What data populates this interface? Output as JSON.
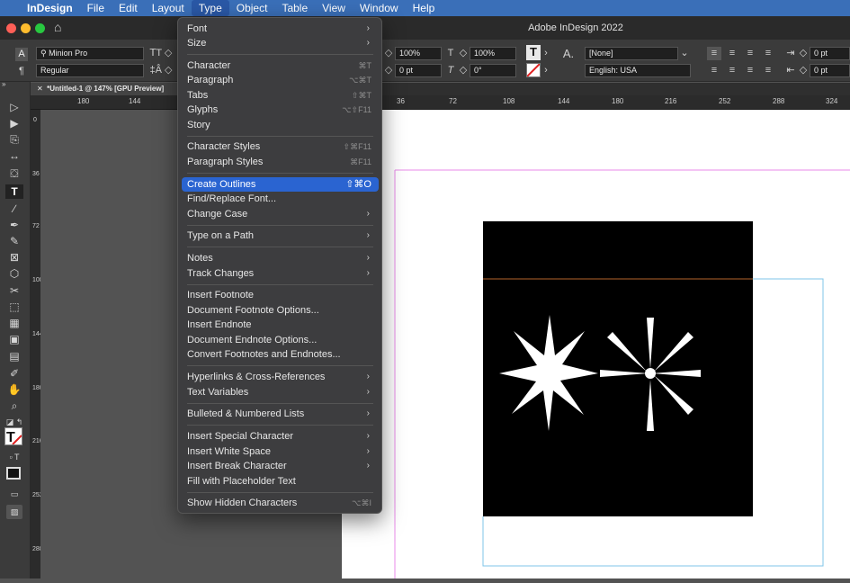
{
  "menubar": {
    "apple": "",
    "items": [
      "InDesign",
      "File",
      "Edit",
      "Layout",
      "Type",
      "Object",
      "Table",
      "View",
      "Window",
      "Help"
    ],
    "active": "Type"
  },
  "window": {
    "title": "Adobe InDesign 2022"
  },
  "control_panel": {
    "font_family": "Minion Pro",
    "font_style": "Regular",
    "vertical_scale": "100%",
    "horizontal_scale": "100%",
    "baseline_shift": "0 pt",
    "skew": "0°",
    "character_style": "[None]",
    "language": "English: USA",
    "left_indent": "0 pt",
    "first_line_indent": "0 pt"
  },
  "document_tab": {
    "label": "*Untitled-1 @ 147% [GPU Preview]"
  },
  "ruler": {
    "horizontal_ticks": [
      "180",
      "144",
      "36",
      "72",
      "108",
      "144",
      "180",
      "216",
      "252",
      "288",
      "324"
    ],
    "vertical_ticks": [
      "0",
      "36",
      "72",
      "108",
      "144",
      "180",
      "216",
      "252",
      "288"
    ]
  },
  "type_menu": {
    "items": [
      {
        "label": "Font",
        "shortcut": "",
        "submenu": true
      },
      {
        "label": "Size",
        "shortcut": "",
        "submenu": true
      },
      {
        "label": "Character",
        "shortcut": "⌘T",
        "submenu": false
      },
      {
        "label": "Paragraph",
        "shortcut": "⌥⌘T",
        "submenu": false
      },
      {
        "label": "Tabs",
        "shortcut": "⇧⌘T",
        "submenu": false
      },
      {
        "label": "Glyphs",
        "shortcut": "⌥⇧F11",
        "submenu": false
      },
      {
        "label": "Story",
        "shortcut": "",
        "submenu": false
      },
      {
        "label": "Character Styles",
        "shortcut": "⇧⌘F11",
        "submenu": false
      },
      {
        "label": "Paragraph Styles",
        "shortcut": "⌘F11",
        "submenu": false
      },
      {
        "label": "Create Outlines",
        "shortcut": "⇧⌘O",
        "submenu": false,
        "highlighted": true
      },
      {
        "label": "Find/Replace Font...",
        "shortcut": "",
        "submenu": false
      },
      {
        "label": "Change Case",
        "shortcut": "",
        "submenu": true
      },
      {
        "label": "Type on a Path",
        "shortcut": "",
        "submenu": true
      },
      {
        "label": "Notes",
        "shortcut": "",
        "submenu": true
      },
      {
        "label": "Track Changes",
        "shortcut": "",
        "submenu": true
      },
      {
        "label": "Insert Footnote",
        "shortcut": "",
        "submenu": false
      },
      {
        "label": "Document Footnote Options...",
        "shortcut": "",
        "submenu": false
      },
      {
        "label": "Insert Endnote",
        "shortcut": "",
        "submenu": false
      },
      {
        "label": "Document Endnote Options...",
        "shortcut": "",
        "submenu": false
      },
      {
        "label": "Convert Footnotes and Endnotes...",
        "shortcut": "",
        "submenu": false
      },
      {
        "label": "Hyperlinks & Cross-References",
        "shortcut": "",
        "submenu": true
      },
      {
        "label": "Text Variables",
        "shortcut": "",
        "submenu": true
      },
      {
        "label": "Bulleted & Numbered Lists",
        "shortcut": "",
        "submenu": true
      },
      {
        "label": "Insert Special Character",
        "shortcut": "",
        "submenu": true
      },
      {
        "label": "Insert White Space",
        "shortcut": "",
        "submenu": true
      },
      {
        "label": "Insert Break Character",
        "shortcut": "",
        "submenu": true
      },
      {
        "label": "Fill with Placeholder Text",
        "shortcut": "",
        "submenu": false
      },
      {
        "label": "Show Hidden Characters",
        "shortcut": "⌥⌘I",
        "submenu": false
      }
    ]
  },
  "colors": {
    "menubar": "#3a6fb8",
    "highlight": "#2a64d1",
    "margin_guide": "#e88ae8",
    "bleed_guide": "#7fc6e8"
  }
}
